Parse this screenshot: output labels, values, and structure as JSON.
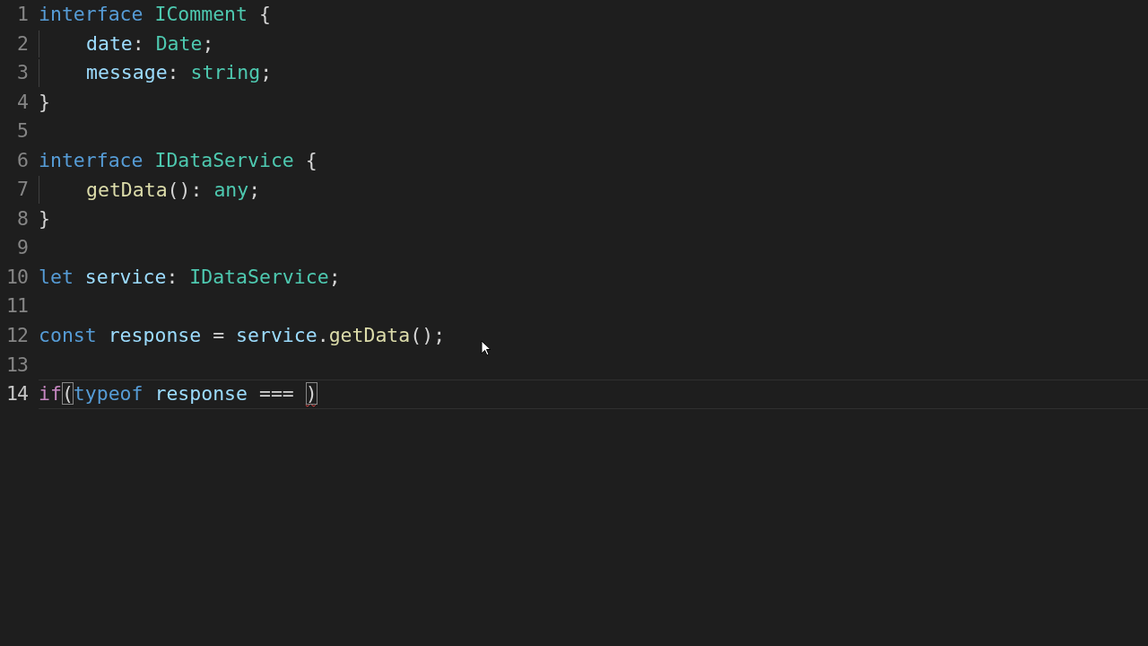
{
  "editor": {
    "lines": [
      {
        "number": "1",
        "current": false,
        "indented": false,
        "tokens": [
          {
            "text": "interface ",
            "kind": "keyword"
          },
          {
            "text": "IComment",
            "kind": "type"
          },
          {
            "text": " {",
            "kind": "punct"
          }
        ]
      },
      {
        "number": "2",
        "current": false,
        "indented": true,
        "tokens": [
          {
            "text": "date",
            "kind": "property"
          },
          {
            "text": ": ",
            "kind": "punct"
          },
          {
            "text": "Date",
            "kind": "type"
          },
          {
            "text": ";",
            "kind": "punct"
          }
        ]
      },
      {
        "number": "3",
        "current": false,
        "indented": true,
        "tokens": [
          {
            "text": "message",
            "kind": "property"
          },
          {
            "text": ": ",
            "kind": "punct"
          },
          {
            "text": "string",
            "kind": "type"
          },
          {
            "text": ";",
            "kind": "punct"
          }
        ]
      },
      {
        "number": "4",
        "current": false,
        "indented": false,
        "tokens": [
          {
            "text": "}",
            "kind": "punct"
          }
        ]
      },
      {
        "number": "5",
        "current": false,
        "indented": false
      },
      {
        "number": "6",
        "current": false,
        "indented": false,
        "tokens": [
          {
            "text": "interface ",
            "kind": "keyword"
          },
          {
            "text": "IDataService",
            "kind": "type"
          },
          {
            "text": " {",
            "kind": "punct"
          }
        ]
      },
      {
        "number": "7",
        "current": false,
        "indented": true,
        "tokens": [
          {
            "text": "getData",
            "kind": "function"
          },
          {
            "text": "(): ",
            "kind": "punct"
          },
          {
            "text": "any",
            "kind": "type"
          },
          {
            "text": ";",
            "kind": "punct"
          }
        ]
      },
      {
        "number": "8",
        "current": false,
        "indented": false,
        "tokens": [
          {
            "text": "}",
            "kind": "punct"
          }
        ]
      },
      {
        "number": "9",
        "current": false,
        "indented": false
      },
      {
        "number": "10",
        "current": false,
        "indented": false,
        "tokens": [
          {
            "text": "let ",
            "kind": "keyword"
          },
          {
            "text": "service",
            "kind": "property"
          },
          {
            "text": ": ",
            "kind": "punct"
          },
          {
            "text": "IDataService",
            "kind": "type"
          },
          {
            "text": ";",
            "kind": "punct"
          }
        ]
      },
      {
        "number": "11",
        "current": false,
        "indented": false
      },
      {
        "number": "12",
        "current": false,
        "indented": false,
        "tokens": [
          {
            "text": "const ",
            "kind": "keyword"
          },
          {
            "text": "response",
            "kind": "property"
          },
          {
            "text": " = ",
            "kind": "punct"
          },
          {
            "text": "service",
            "kind": "property"
          },
          {
            "text": ".",
            "kind": "punct"
          },
          {
            "text": "getData",
            "kind": "function"
          },
          {
            "text": "();",
            "kind": "punct"
          }
        ]
      },
      {
        "number": "13",
        "current": false,
        "indented": false
      },
      {
        "number": "14",
        "current": true,
        "indented": false,
        "tokens": [
          {
            "text": "if",
            "kind": "control"
          },
          {
            "text": "(",
            "kind": "punct",
            "bracket_match": true
          },
          {
            "text": "typeof ",
            "kind": "keyword"
          },
          {
            "text": "response",
            "kind": "property"
          },
          {
            "text": " === ",
            "kind": "punct"
          },
          {
            "text": ")",
            "kind": "punct",
            "bracket_match": true,
            "error": true
          }
        ]
      }
    ]
  }
}
